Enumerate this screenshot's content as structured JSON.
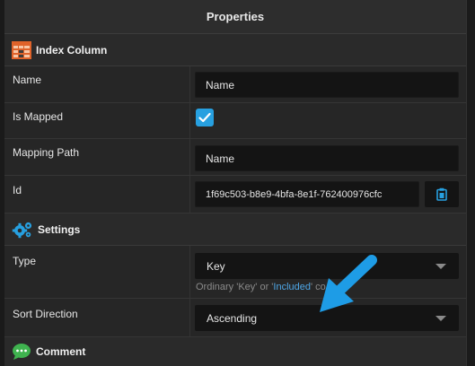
{
  "panel": {
    "title": "Properties"
  },
  "index_column": {
    "header": "Index Column",
    "name_label": "Name",
    "name_value": "Name",
    "is_mapped_label": "Is Mapped",
    "is_mapped_checked": true,
    "mapping_path_label": "Mapping Path",
    "mapping_path_value": "Name",
    "id_label": "Id",
    "id_value": "1f69c503-b8e9-4bfa-8e1f-762400976cfc"
  },
  "settings": {
    "header": "Settings",
    "type_label": "Type",
    "type_value": "Key",
    "type_hint_prefix": "Ordinary 'Key' or '",
    "type_hint_highlight": "Included",
    "type_hint_suffix": "' co",
    "sort_direction_label": "Sort Direction",
    "sort_direction_value": "Ascending"
  },
  "comment": {
    "header": "Comment"
  },
  "colors": {
    "accent": "#27a0e0",
    "arrow": "#1e9ce6",
    "background": "#252526"
  },
  "icons": [
    "table-icon",
    "checkmark-icon",
    "clipboard-icon",
    "gears-icon",
    "chevron-down-icon",
    "speech-bubble-icon",
    "arrow-pointer-icon"
  ]
}
